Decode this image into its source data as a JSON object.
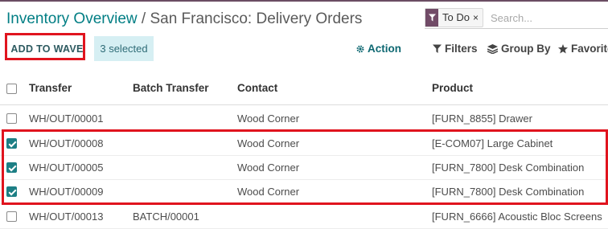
{
  "breadcrumb": {
    "parent": "Inventory Overview",
    "separator": " / ",
    "current": "San Francisco: Delivery Orders"
  },
  "search": {
    "facet_label": "To Do",
    "facet_remove": "×",
    "placeholder": "Search..."
  },
  "toolbar": {
    "add_to_wave": "ADD TO WAVE",
    "selected_count": "3 selected",
    "action": "Action",
    "filters": "Filters",
    "group_by": "Group By",
    "favorites": "Favorites"
  },
  "table": {
    "headers": {
      "transfer": "Transfer",
      "batch": "Batch Transfer",
      "contact": "Contact",
      "product": "Product"
    },
    "rows": [
      {
        "checked": false,
        "transfer": "WH/OUT/00001",
        "batch": "",
        "contact": "Wood Corner",
        "product": "[FURN_8855] Drawer"
      },
      {
        "checked": true,
        "transfer": "WH/OUT/00008",
        "batch": "",
        "contact": "Wood Corner",
        "product": "[E-COM07] Large Cabinet"
      },
      {
        "checked": true,
        "transfer": "WH/OUT/00005",
        "batch": "",
        "contact": "Wood Corner",
        "product": "[FURN_7800] Desk Combination"
      },
      {
        "checked": true,
        "transfer": "WH/OUT/00009",
        "batch": "",
        "contact": "Wood Corner",
        "product": "[FURN_7800] Desk Combination"
      },
      {
        "checked": false,
        "transfer": "WH/OUT/00013",
        "batch": "BATCH/00001",
        "contact": "",
        "product": "[FURN_6666] Acoustic Bloc Screens"
      }
    ]
  },
  "colors": {
    "accent": "#017e84",
    "brand": "#714b67",
    "highlight": "#e0141e",
    "selected_bg": "#d6eff3",
    "checkbox_on": "#1d7f85"
  }
}
